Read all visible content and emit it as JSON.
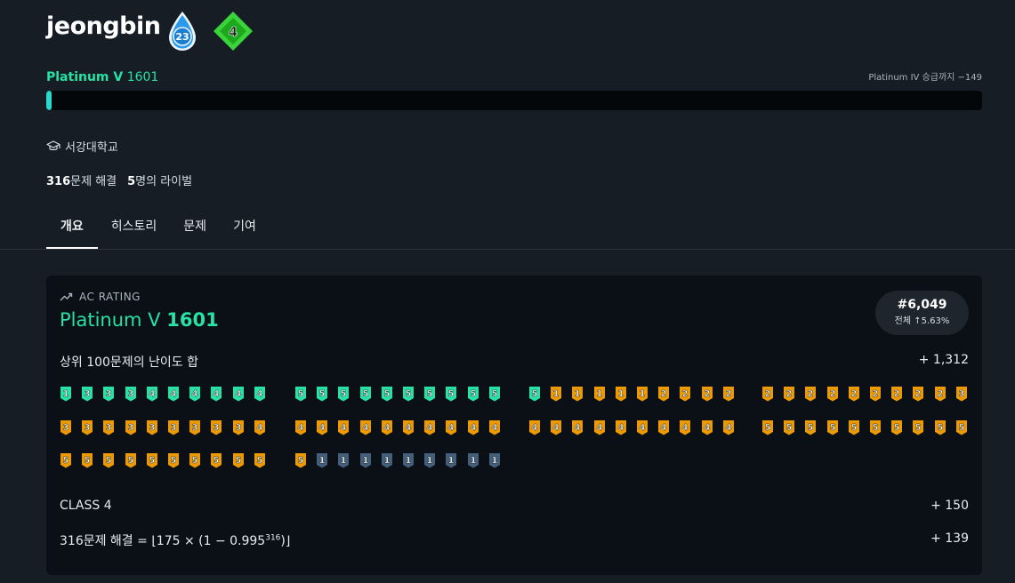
{
  "profile": {
    "username": "jeongbin",
    "drop_badge": "23",
    "diamond_badge": "4",
    "tier": "Platinum V",
    "rating": "1601",
    "promotion_text": "Platinum IV 승급까지 −149",
    "progress_fraction": 0.006,
    "school_icon": "graduation-cap-icon",
    "school": "서강대학교",
    "solved_count": "316",
    "solved_label": "문제 해결",
    "rival_count": "5",
    "rival_label": "명의 라이벌"
  },
  "tabs": [
    {
      "label": "개요",
      "active": true
    },
    {
      "label": "히스토리",
      "active": false
    },
    {
      "label": "문제",
      "active": false
    },
    {
      "label": "기여",
      "active": false
    }
  ],
  "ac_rating": {
    "label_icon": "trending-up-icon",
    "label": "AC RATING",
    "tier": "Platinum V",
    "rating": "1601",
    "rank": "#6,049",
    "percentile": "전체 ↑5.63%",
    "top100_label": "상위 100문제의 난이도 합",
    "top100_value": "+ 1,312",
    "class_label": "CLASS 4",
    "class_value": "+ 150",
    "solved_formula_prefix": "316문제 해결 = ⌊175 × (1 − 0.995",
    "solved_formula_exp": "316",
    "solved_formula_suffix": ")⌋",
    "solved_value": "+ 139"
  },
  "badge_colors": {
    "platinum": "#27e2a4",
    "gold": "#ec9a00",
    "silver": "#435f7a"
  },
  "badges": [
    [
      [
        "platinum",
        1
      ],
      [
        "platinum",
        3
      ],
      [
        "platinum",
        3
      ],
      [
        "platinum",
        3
      ],
      [
        "platinum",
        4
      ],
      [
        "platinum",
        4
      ],
      [
        "platinum",
        4
      ],
      [
        "platinum",
        4
      ],
      [
        "platinum",
        4
      ],
      [
        "platinum",
        4
      ],
      [
        "platinum",
        5
      ],
      [
        "platinum",
        5
      ],
      [
        "platinum",
        5
      ],
      [
        "platinum",
        5
      ],
      [
        "platinum",
        5
      ],
      [
        "platinum",
        5
      ],
      [
        "platinum",
        5
      ],
      [
        "platinum",
        5
      ],
      [
        "platinum",
        5
      ],
      [
        "platinum",
        5
      ],
      [
        "platinum",
        5
      ],
      [
        "gold",
        1
      ],
      [
        "gold",
        1
      ],
      [
        "gold",
        1
      ],
      [
        "gold",
        1
      ],
      [
        "gold",
        1
      ],
      [
        "gold",
        2
      ],
      [
        "gold",
        2
      ],
      [
        "gold",
        2
      ],
      [
        "gold",
        2
      ],
      [
        "gold",
        2
      ],
      [
        "gold",
        2
      ],
      [
        "gold",
        2
      ],
      [
        "gold",
        2
      ],
      [
        "gold",
        2
      ],
      [
        "gold",
        2
      ],
      [
        "gold",
        2
      ],
      [
        "gold",
        2
      ],
      [
        "gold",
        2
      ],
      [
        "gold",
        3
      ]
    ],
    [
      [
        "gold",
        3
      ],
      [
        "gold",
        3
      ],
      [
        "gold",
        3
      ],
      [
        "gold",
        3
      ],
      [
        "gold",
        3
      ],
      [
        "gold",
        3
      ],
      [
        "gold",
        3
      ],
      [
        "gold",
        3
      ],
      [
        "gold",
        3
      ],
      [
        "gold",
        4
      ],
      [
        "gold",
        4
      ],
      [
        "gold",
        4
      ],
      [
        "gold",
        4
      ],
      [
        "gold",
        4
      ],
      [
        "gold",
        4
      ],
      [
        "gold",
        4
      ],
      [
        "gold",
        4
      ],
      [
        "gold",
        4
      ],
      [
        "gold",
        4
      ],
      [
        "gold",
        4
      ],
      [
        "gold",
        4
      ],
      [
        "gold",
        4
      ],
      [
        "gold",
        4
      ],
      [
        "gold",
        4
      ],
      [
        "gold",
        4
      ],
      [
        "gold",
        4
      ],
      [
        "gold",
        4
      ],
      [
        "gold",
        4
      ],
      [
        "gold",
        4
      ],
      [
        "gold",
        4
      ],
      [
        "gold",
        5
      ],
      [
        "gold",
        5
      ],
      [
        "gold",
        5
      ],
      [
        "gold",
        5
      ],
      [
        "gold",
        5
      ],
      [
        "gold",
        5
      ],
      [
        "gold",
        5
      ],
      [
        "gold",
        5
      ],
      [
        "gold",
        5
      ],
      [
        "gold",
        5
      ]
    ],
    [
      [
        "gold",
        5
      ],
      [
        "gold",
        5
      ],
      [
        "gold",
        5
      ],
      [
        "gold",
        5
      ],
      [
        "gold",
        5
      ],
      [
        "gold",
        5
      ],
      [
        "gold",
        5
      ],
      [
        "gold",
        5
      ],
      [
        "gold",
        5
      ],
      [
        "gold",
        5
      ],
      [
        "gold",
        5
      ],
      [
        "silver",
        1
      ],
      [
        "silver",
        1
      ],
      [
        "silver",
        1
      ],
      [
        "silver",
        1
      ],
      [
        "silver",
        1
      ],
      [
        "silver",
        1
      ],
      [
        "silver",
        1
      ],
      [
        "silver",
        1
      ],
      [
        "silver",
        1
      ]
    ]
  ]
}
